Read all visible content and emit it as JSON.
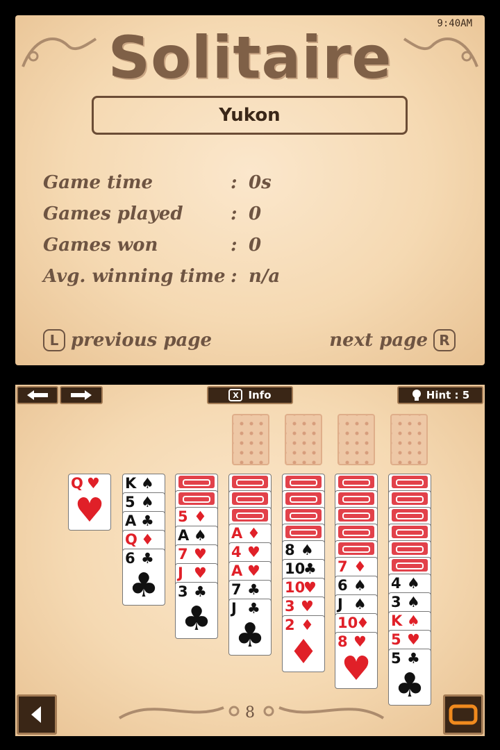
{
  "top": {
    "clock": "9:40AM",
    "title": "Solitaire",
    "mode": "Yukon",
    "stats": [
      {
        "label": "Game time",
        "value": "0s"
      },
      {
        "label": "Games played",
        "value": "0"
      },
      {
        "label": "Games won",
        "value": "0"
      },
      {
        "label": "Avg. winning time",
        "value": "n/a"
      }
    ],
    "prev_button_letter": "L",
    "prev_label": "previous page",
    "next_label": "next page",
    "next_button_letter": "R"
  },
  "toolbar": {
    "undo_icon": "undo-arrow-icon",
    "redo_icon": "redo-arrow-icon",
    "info_key": "X",
    "info_label": "Info",
    "hint_label": "Hint : 5"
  },
  "waste": {
    "rank": "Q",
    "suit": "♥",
    "color": "red"
  },
  "tableau": [
    {
      "backs": 0,
      "cards": [
        {
          "rank": "K",
          "suit": "♠",
          "color": "black"
        },
        {
          "rank": "5",
          "suit": "♠",
          "color": "black"
        },
        {
          "rank": "A",
          "suit": "♣",
          "color": "black"
        },
        {
          "rank": "Q",
          "suit": "♦",
          "color": "red"
        },
        {
          "rank": "6",
          "suit": "♣",
          "color": "black"
        }
      ]
    },
    {
      "backs": 2,
      "cards": [
        {
          "rank": "5",
          "suit": "♦",
          "color": "red"
        },
        {
          "rank": "A",
          "suit": "♠",
          "color": "black"
        },
        {
          "rank": "7",
          "suit": "♥",
          "color": "red"
        },
        {
          "rank": "J",
          "suit": "♥",
          "color": "red"
        },
        {
          "rank": "3",
          "suit": "♣",
          "color": "black"
        }
      ]
    },
    {
      "backs": 3,
      "cards": [
        {
          "rank": "A",
          "suit": "♦",
          "color": "red"
        },
        {
          "rank": "4",
          "suit": "♥",
          "color": "red"
        },
        {
          "rank": "A",
          "suit": "♥",
          "color": "red"
        },
        {
          "rank": "7",
          "suit": "♣",
          "color": "black"
        },
        {
          "rank": "J",
          "suit": "♣",
          "color": "black"
        }
      ]
    },
    {
      "backs": 4,
      "cards": [
        {
          "rank": "8",
          "suit": "♠",
          "color": "black"
        },
        {
          "rank": "10",
          "suit": "♣",
          "color": "black"
        },
        {
          "rank": "10",
          "suit": "♥",
          "color": "red"
        },
        {
          "rank": "3",
          "suit": "♥",
          "color": "red"
        },
        {
          "rank": "2",
          "suit": "♦",
          "color": "red"
        }
      ]
    },
    {
      "backs": 5,
      "cards": [
        {
          "rank": "7",
          "suit": "♦",
          "color": "red"
        },
        {
          "rank": "6",
          "suit": "♠",
          "color": "black"
        },
        {
          "rank": "J",
          "suit": "♠",
          "color": "black"
        },
        {
          "rank": "10",
          "suit": "♦",
          "color": "red"
        },
        {
          "rank": "8",
          "suit": "♥",
          "color": "red"
        }
      ]
    },
    {
      "backs": 6,
      "cards": [
        {
          "rank": "4",
          "suit": "♠",
          "color": "black"
        },
        {
          "rank": "3",
          "suit": "♠",
          "color": "black"
        },
        {
          "rank": "K",
          "suit": "♠",
          "color": "red"
        },
        {
          "rank": "5",
          "suit": "♥",
          "color": "red"
        },
        {
          "rank": "5",
          "suit": "♣",
          "color": "black"
        }
      ]
    }
  ],
  "page_number": "8",
  "colors": {
    "red_suit": "#e02028",
    "black_suit": "#111111",
    "parchment": "#f5d9b2",
    "brown_text": "#6e5442"
  }
}
